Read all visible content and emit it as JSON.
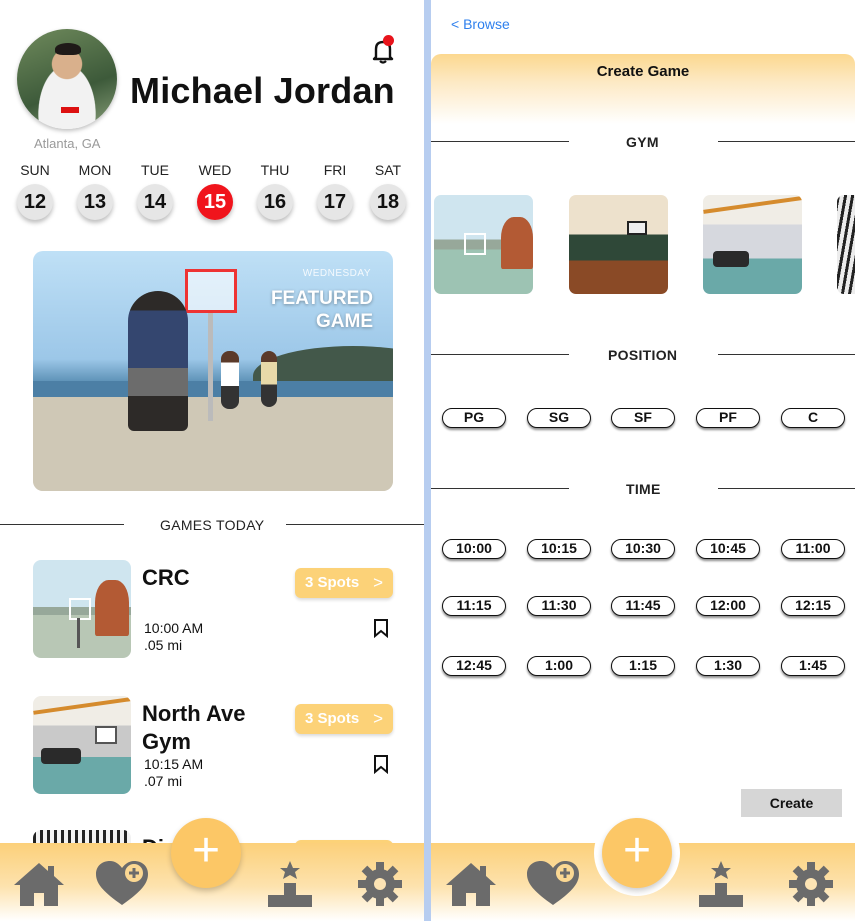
{
  "profile": {
    "name": "Michael Jordan",
    "location": "Atlanta, GA"
  },
  "week": [
    {
      "day": "SUN",
      "date": "12"
    },
    {
      "day": "MON",
      "date": "13"
    },
    {
      "day": "TUE",
      "date": "14"
    },
    {
      "day": "WED",
      "date": "15",
      "selected": true
    },
    {
      "day": "THU",
      "date": "16"
    },
    {
      "day": "FRI",
      "date": "17"
    },
    {
      "day": "SAT",
      "date": "18"
    }
  ],
  "featured": {
    "day": "WEDNESDAY",
    "title_line1": "FEATURED",
    "title_line2": "GAME"
  },
  "games_section": "GAMES TODAY",
  "games": [
    {
      "name": "CRC",
      "time": "10:00 AM",
      "distance": ".05 mi",
      "spots": "3 Spots"
    },
    {
      "name": "North Ave Gym",
      "time": "10:15 AM",
      "distance": ".07 mi",
      "spots": "3 Spots"
    },
    {
      "name": "Die",
      "suffix": "t"
    }
  ],
  "create_game": {
    "back_label": "< Browse",
    "title": "Create Game",
    "gym_label": "GYM",
    "position_label": "POSITION",
    "time_label": "TIME",
    "positions": [
      "PG",
      "SG",
      "SF",
      "PF",
      "C"
    ],
    "times": [
      "10:00",
      "10:15",
      "10:30",
      "10:45",
      "11:00",
      "11:15",
      "11:30",
      "11:45",
      "12:00",
      "12:15",
      "12:45",
      "1:00",
      "1:15",
      "1:30",
      "1:45"
    ],
    "create_label": "Create"
  },
  "nav": {
    "add_symbol": "+",
    "icons": [
      "home-icon",
      "heart-plus-icon",
      "add-icon",
      "leaderboard-icon",
      "settings-icon"
    ]
  },
  "colors": {
    "accent": "#fcc766",
    "selected_day": "#f0141c",
    "notification": "#e8131b",
    "link": "#2f80ed"
  }
}
